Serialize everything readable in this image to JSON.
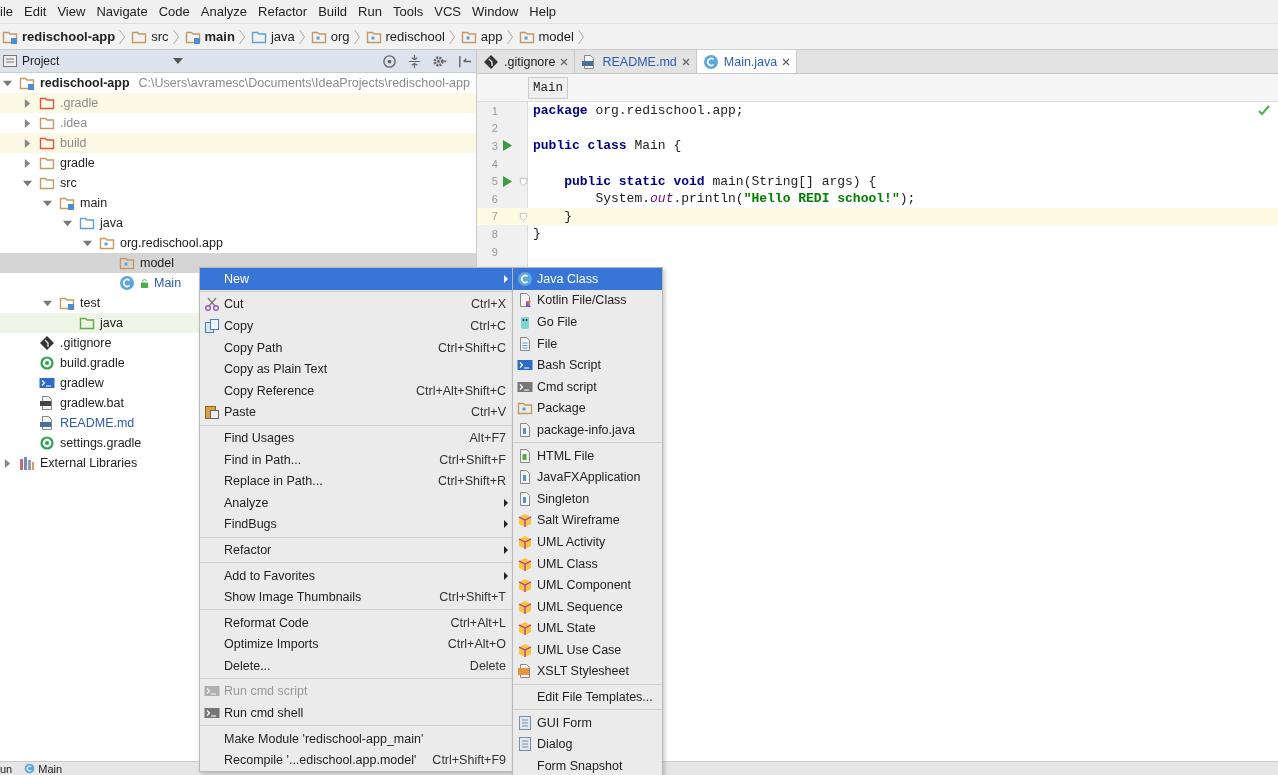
{
  "menu_bar": [
    "ile",
    "Edit",
    "View",
    "Navigate",
    "Code",
    "Analyze",
    "Refactor",
    "Build",
    "Run",
    "Tools",
    "VCS",
    "Window",
    "Help"
  ],
  "breadcrumbs": [
    {
      "label": "redischool-app",
      "kind": "module",
      "bold": true
    },
    {
      "label": "src",
      "kind": "folder",
      "bold": false
    },
    {
      "label": "main",
      "kind": "module",
      "bold": true
    },
    {
      "label": "java",
      "kind": "source",
      "bold": false
    },
    {
      "label": "org",
      "kind": "package",
      "bold": false
    },
    {
      "label": "redischool",
      "kind": "package",
      "bold": false
    },
    {
      "label": "app",
      "kind": "package",
      "bold": false
    },
    {
      "label": "model",
      "kind": "package",
      "bold": false
    }
  ],
  "project_panel": {
    "title": "Project",
    "tree": [
      {
        "label": "redischool-app",
        "path": "C:\\Users\\avramesc\\Documents\\IdeaProjects\\redischool-app",
        "kind": "module",
        "bold": true,
        "selected": false,
        "expanded": true,
        "children": [
          {
            "label": ".gradle",
            "kind": "folder",
            "excluded": true,
            "selected": false,
            "expanded": false
          },
          {
            "label": ".idea",
            "kind": "folder",
            "ignored": true,
            "selected": false,
            "expanded": false
          },
          {
            "label": "build",
            "kind": "folder",
            "excluded": true,
            "selected": false,
            "expanded": false
          },
          {
            "label": "gradle",
            "kind": "folder",
            "selected": false,
            "expanded": false
          },
          {
            "label": "src",
            "kind": "folder",
            "selected": false,
            "expanded": true,
            "children": [
              {
                "label": "main",
                "kind": "module",
                "selected": false,
                "expanded": true,
                "children": [
                  {
                    "label": "java",
                    "kind": "source",
                    "selected": false,
                    "expanded": true,
                    "children": [
                      {
                        "label": "org.redischool.app",
                        "kind": "package",
                        "selected": false,
                        "expanded": true,
                        "children": [
                          {
                            "label": "model",
                            "kind": "package",
                            "selected": true
                          },
                          {
                            "label": "Main",
                            "kind": "java-class",
                            "modified": true,
                            "selected": false
                          }
                        ]
                      }
                    ]
                  }
                ]
              },
              {
                "label": "test",
                "kind": "module",
                "selected": false,
                "expanded": true,
                "children": [
                  {
                    "label": "java",
                    "kind": "test",
                    "selected": false
                  }
                ]
              }
            ]
          },
          {
            "label": ".gitignore",
            "kind": "git",
            "selected": false
          },
          {
            "label": "build.gradle",
            "kind": "gradle",
            "selected": false
          },
          {
            "label": "gradlew",
            "kind": "terminal",
            "selected": false
          },
          {
            "label": "gradlew.bat",
            "kind": "bat",
            "selected": false
          },
          {
            "label": "README.md",
            "kind": "md",
            "modified": true,
            "selected": false
          },
          {
            "label": "settings.gradle",
            "kind": "gradle",
            "selected": false
          }
        ]
      },
      {
        "label": "External Libraries",
        "kind": "library",
        "selected": false,
        "expanded": false
      }
    ]
  },
  "editor": {
    "tabs": [
      {
        "label": ".gitignore",
        "kind": "git",
        "selected": false
      },
      {
        "label": "README.md",
        "kind": "md",
        "selected": false
      },
      {
        "label": "Main.java",
        "kind": "java-class",
        "selected": true
      }
    ],
    "breadcrumb": "Main",
    "lines": [
      {
        "number": "1",
        "tokens": [
          {
            "text": "package",
            "kind": "keyword"
          },
          {
            "text": " org.redischool.app;",
            "kind": "plain"
          }
        ]
      },
      {
        "number": "2"
      },
      {
        "number": "3",
        "run": true,
        "tokens": [
          {
            "text": "public class",
            "kind": "keyword"
          },
          {
            "text": " Main {",
            "kind": "plain"
          }
        ]
      },
      {
        "number": "4"
      },
      {
        "number": "5",
        "run": true,
        "fold": true,
        "tokens": [
          {
            "text": "    public static void",
            "kind": "keyword"
          },
          {
            "text": " main(String[] args) {",
            "kind": "plain"
          }
        ]
      },
      {
        "number": "6",
        "tokens": [
          {
            "text": "        System.",
            "kind": "plain"
          },
          {
            "text": "out",
            "kind": "field"
          },
          {
            "text": ".println(",
            "kind": "plain"
          },
          {
            "text": "\"Hello REDI school!\"",
            "kind": "string"
          },
          {
            "text": ");",
            "kind": "plain"
          }
        ]
      },
      {
        "number": "7",
        "current": true,
        "fold": true,
        "tokens": [
          {
            "text": "    }",
            "kind": "plain"
          }
        ]
      },
      {
        "number": "8",
        "tokens": [
          {
            "text": "}",
            "kind": "plain"
          }
        ]
      },
      {
        "number": "9"
      }
    ]
  },
  "context_menu": {
    "groups": [
      [
        {
          "label": "New",
          "submenu": true,
          "selected": true,
          "disabled": false
        }
      ],
      [
        {
          "label": "Cut",
          "shortcut": "Ctrl+X",
          "kind": "cut",
          "selected": false,
          "disabled": false
        },
        {
          "label": "Copy",
          "shortcut": "Ctrl+C",
          "kind": "copy",
          "selected": false,
          "disabled": false
        },
        {
          "label": "Copy Path",
          "shortcut": "Ctrl+Shift+C",
          "selected": false,
          "disabled": false
        },
        {
          "label": "Copy as Plain Text",
          "selected": false,
          "disabled": false
        },
        {
          "label": "Copy Reference",
          "shortcut": "Ctrl+Alt+Shift+C",
          "selected": false,
          "disabled": false
        },
        {
          "label": "Paste",
          "shortcut": "Ctrl+V",
          "kind": "paste",
          "selected": false,
          "disabled": false
        }
      ],
      [
        {
          "label": "Find Usages",
          "shortcut": "Alt+F7",
          "selected": false,
          "disabled": false
        },
        {
          "label": "Find in Path...",
          "shortcut": "Ctrl+Shift+F",
          "selected": false,
          "disabled": false
        },
        {
          "label": "Replace in Path...",
          "shortcut": "Ctrl+Shift+R",
          "selected": false,
          "disabled": false
        },
        {
          "label": "Analyze",
          "submenu": true,
          "selected": false,
          "disabled": false
        },
        {
          "label": "FindBugs",
          "submenu": true,
          "selected": false,
          "disabled": false
        }
      ],
      [
        {
          "label": "Refactor",
          "submenu": true,
          "selected": false,
          "disabled": false
        }
      ],
      [
        {
          "label": "Add to Favorites",
          "submenu": true,
          "selected": false,
          "disabled": false
        },
        {
          "label": "Show Image Thumbnails",
          "shortcut": "Ctrl+Shift+T",
          "selected": false,
          "disabled": false
        }
      ],
      [
        {
          "label": "Reformat Code",
          "shortcut": "Ctrl+Alt+L",
          "selected": false,
          "disabled": false
        },
        {
          "label": "Optimize Imports",
          "shortcut": "Ctrl+Alt+O",
          "selected": false,
          "disabled": false
        },
        {
          "label": "Delete...",
          "shortcut": "Delete",
          "selected": false,
          "disabled": false
        }
      ],
      [
        {
          "label": "Run cmd script",
          "kind": "cmd",
          "selected": false,
          "disabled": true
        },
        {
          "label": "Run cmd shell",
          "kind": "cmd",
          "selected": false,
          "disabled": false
        }
      ],
      [
        {
          "label": "Make Module 'redischool-app_main'",
          "selected": false,
          "disabled": false
        },
        {
          "label": "Recompile '...edischool.app.model'",
          "shortcut": "Ctrl+Shift+F9",
          "selected": false,
          "disabled": false
        }
      ]
    ]
  },
  "submenu": {
    "groups": [
      [
        {
          "label": "Java Class",
          "kind": "java-class",
          "selected": true
        },
        {
          "label": "Kotlin File/Class",
          "kind": "kotlin",
          "selected": false
        },
        {
          "label": "Go File",
          "kind": "go",
          "selected": false
        },
        {
          "label": "File",
          "kind": "file",
          "selected": false
        },
        {
          "label": "Bash Script",
          "kind": "terminal",
          "selected": false
        },
        {
          "label": "Cmd script",
          "kind": "cmd",
          "selected": false
        },
        {
          "label": "Package",
          "kind": "package",
          "selected": false
        },
        {
          "label": "package-info.java",
          "kind": "info",
          "selected": false
        }
      ],
      [
        {
          "label": "HTML File",
          "kind": "html",
          "selected": false
        },
        {
          "label": "JavaFXApplication",
          "kind": "info",
          "selected": false
        },
        {
          "label": "Singleton",
          "kind": "info",
          "selected": false
        },
        {
          "label": "Salt Wireframe",
          "kind": "uml",
          "selected": false
        },
        {
          "label": "UML Activity",
          "kind": "uml",
          "selected": false
        },
        {
          "label": "UML Class",
          "kind": "uml",
          "selected": false
        },
        {
          "label": "UML Component",
          "kind": "uml",
          "selected": false
        },
        {
          "label": "UML Sequence",
          "kind": "uml",
          "selected": false
        },
        {
          "label": "UML State",
          "kind": "uml",
          "selected": false
        },
        {
          "label": "UML Use Case",
          "kind": "uml",
          "selected": false
        },
        {
          "label": "XSLT Stylesheet",
          "kind": "xslt",
          "selected": false
        }
      ],
      [
        {
          "label": "Edit File Templates...",
          "selected": false
        }
      ],
      [
        {
          "label": "GUI Form",
          "kind": "form",
          "selected": false
        },
        {
          "label": "Dialog",
          "kind": "form",
          "selected": false
        },
        {
          "label": "Form Snapshot",
          "selected": false
        }
      ]
    ]
  },
  "status_bar": [
    {
      "label": "un"
    },
    {
      "label": "Main",
      "kind": "java-class"
    }
  ]
}
